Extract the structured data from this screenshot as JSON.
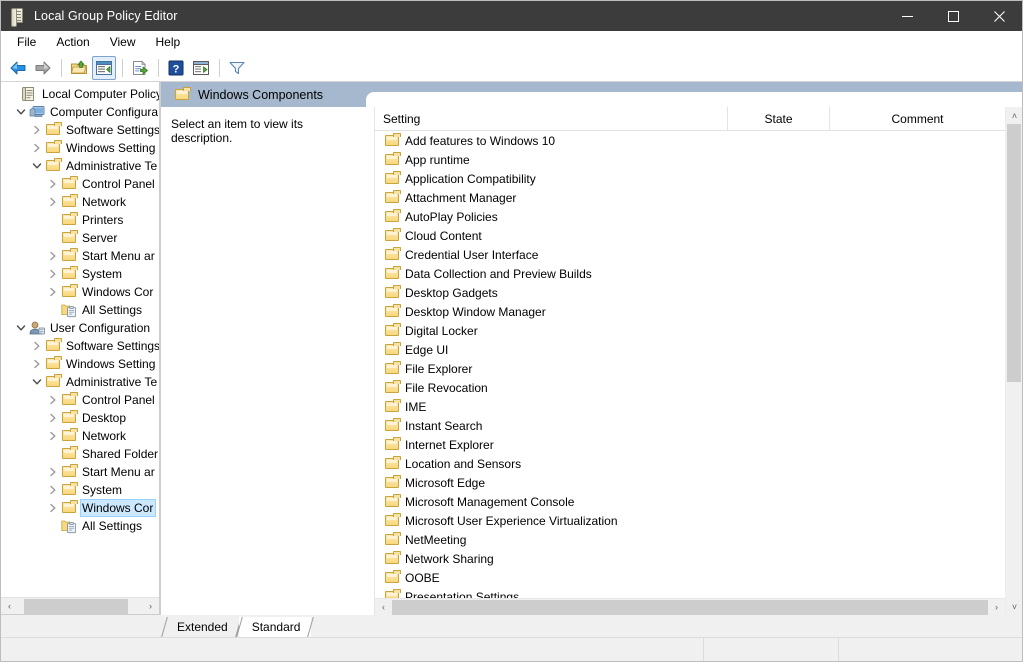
{
  "window": {
    "title": "Local Group Policy Editor",
    "icon": "scroll-policy-icon",
    "minimize_label": "—",
    "maximize_label": "□",
    "close_label": "✕"
  },
  "menubar": {
    "items": [
      {
        "label": "File"
      },
      {
        "label": "Action"
      },
      {
        "label": "View"
      },
      {
        "label": "Help"
      }
    ]
  },
  "toolbar": {
    "buttons": [
      {
        "name": "back-icon",
        "tip": "Back"
      },
      {
        "name": "forward-icon",
        "tip": "Forward"
      },
      {
        "name": "up-folder-icon",
        "tip": "Up One Level"
      },
      {
        "name": "show-hide-console-tree-icon",
        "tip": "Show/Hide Console Tree",
        "active": true
      },
      {
        "name": "export-list-icon",
        "tip": "Export List"
      },
      {
        "name": "help-icon",
        "tip": "Help"
      },
      {
        "name": "show-action-pane-icon",
        "tip": "Show/Hide Action Pane"
      },
      {
        "name": "filter-icon",
        "tip": "Filter"
      }
    ]
  },
  "tree": {
    "root": "Local Computer Policy",
    "nodes": [
      {
        "label": "Local Computer Policy",
        "depth": 0,
        "icon": "policy-icon",
        "twist": "none",
        "selected": false
      },
      {
        "label": "Computer Configura",
        "depth": 1,
        "icon": "computer-icon",
        "twist": "expanded",
        "selected": false
      },
      {
        "label": "Software Settings",
        "depth": 2,
        "icon": "folder",
        "twist": "collapsed",
        "selected": false
      },
      {
        "label": "Windows Setting",
        "depth": 2,
        "icon": "folder",
        "twist": "collapsed",
        "selected": false
      },
      {
        "label": "Administrative Te",
        "depth": 2,
        "icon": "folder",
        "twist": "expanded",
        "selected": false
      },
      {
        "label": "Control Panel",
        "depth": 3,
        "icon": "folder",
        "twist": "collapsed",
        "selected": false
      },
      {
        "label": "Network",
        "depth": 3,
        "icon": "folder",
        "twist": "collapsed",
        "selected": false
      },
      {
        "label": "Printers",
        "depth": 3,
        "icon": "folder",
        "twist": "none",
        "selected": false
      },
      {
        "label": "Server",
        "depth": 3,
        "icon": "folder",
        "twist": "none",
        "selected": false
      },
      {
        "label": "Start Menu ar",
        "depth": 3,
        "icon": "folder",
        "twist": "collapsed",
        "selected": false
      },
      {
        "label": "System",
        "depth": 3,
        "icon": "folder",
        "twist": "collapsed",
        "selected": false
      },
      {
        "label": "Windows Cor",
        "depth": 3,
        "icon": "folder",
        "twist": "collapsed",
        "selected": false
      },
      {
        "label": "All Settings",
        "depth": 3,
        "icon": "all-settings-icon",
        "twist": "none",
        "selected": false
      },
      {
        "label": "User Configuration",
        "depth": 1,
        "icon": "user-icon",
        "twist": "expanded",
        "selected": false
      },
      {
        "label": "Software Settings",
        "depth": 2,
        "icon": "folder",
        "twist": "collapsed",
        "selected": false
      },
      {
        "label": "Windows Setting",
        "depth": 2,
        "icon": "folder",
        "twist": "collapsed",
        "selected": false
      },
      {
        "label": "Administrative Te",
        "depth": 2,
        "icon": "folder",
        "twist": "expanded",
        "selected": false
      },
      {
        "label": "Control Panel",
        "depth": 3,
        "icon": "folder",
        "twist": "collapsed",
        "selected": false
      },
      {
        "label": "Desktop",
        "depth": 3,
        "icon": "folder",
        "twist": "collapsed",
        "selected": false
      },
      {
        "label": "Network",
        "depth": 3,
        "icon": "folder",
        "twist": "collapsed",
        "selected": false
      },
      {
        "label": "Shared Folder",
        "depth": 3,
        "icon": "folder",
        "twist": "none",
        "selected": false
      },
      {
        "label": "Start Menu ar",
        "depth": 3,
        "icon": "folder",
        "twist": "collapsed",
        "selected": false
      },
      {
        "label": "System",
        "depth": 3,
        "icon": "folder",
        "twist": "collapsed",
        "selected": false
      },
      {
        "label": "Windows Cor",
        "depth": 3,
        "icon": "folder",
        "twist": "collapsed",
        "selected": true
      },
      {
        "label": "All Settings",
        "depth": 3,
        "icon": "all-settings-icon",
        "twist": "none",
        "selected": false
      }
    ],
    "hscroll": {
      "left_arrow": "‹",
      "right_arrow": "›"
    }
  },
  "content": {
    "header_title": "Windows Components",
    "header_icon": "folder-icon",
    "description": "Select an item to view its description.",
    "columns": [
      {
        "label": "Setting",
        "key": "setting"
      },
      {
        "label": "State",
        "key": "state"
      },
      {
        "label": "Comment",
        "key": "comment"
      }
    ],
    "rows": [
      {
        "setting": "Add features to Windows 10",
        "state": "",
        "comment": ""
      },
      {
        "setting": "App runtime",
        "state": "",
        "comment": ""
      },
      {
        "setting": "Application Compatibility",
        "state": "",
        "comment": ""
      },
      {
        "setting": "Attachment Manager",
        "state": "",
        "comment": ""
      },
      {
        "setting": "AutoPlay Policies",
        "state": "",
        "comment": ""
      },
      {
        "setting": "Cloud Content",
        "state": "",
        "comment": ""
      },
      {
        "setting": "Credential User Interface",
        "state": "",
        "comment": ""
      },
      {
        "setting": "Data Collection and Preview Builds",
        "state": "",
        "comment": ""
      },
      {
        "setting": "Desktop Gadgets",
        "state": "",
        "comment": ""
      },
      {
        "setting": "Desktop Window Manager",
        "state": "",
        "comment": ""
      },
      {
        "setting": "Digital Locker",
        "state": "",
        "comment": ""
      },
      {
        "setting": "Edge UI",
        "state": "",
        "comment": ""
      },
      {
        "setting": "File Explorer",
        "state": "",
        "comment": ""
      },
      {
        "setting": "File Revocation",
        "state": "",
        "comment": ""
      },
      {
        "setting": "IME",
        "state": "",
        "comment": ""
      },
      {
        "setting": "Instant Search",
        "state": "",
        "comment": ""
      },
      {
        "setting": "Internet Explorer",
        "state": "",
        "comment": ""
      },
      {
        "setting": "Location and Sensors",
        "state": "",
        "comment": ""
      },
      {
        "setting": "Microsoft Edge",
        "state": "",
        "comment": ""
      },
      {
        "setting": "Microsoft Management Console",
        "state": "",
        "comment": ""
      },
      {
        "setting": "Microsoft User Experience Virtualization",
        "state": "",
        "comment": ""
      },
      {
        "setting": "NetMeeting",
        "state": "",
        "comment": ""
      },
      {
        "setting": "Network Sharing",
        "state": "",
        "comment": ""
      },
      {
        "setting": "OOBE",
        "state": "",
        "comment": ""
      },
      {
        "setting": "Presentation Settings",
        "state": "",
        "comment": ""
      }
    ],
    "vscroll": {
      "up_arrow": "˄",
      "down_arrow": "˅"
    },
    "hscroll": {
      "left_arrow": "‹",
      "right_arrow": "›"
    }
  },
  "tabs": [
    {
      "label": "Extended",
      "active": false
    },
    {
      "label": "Standard",
      "active": true
    }
  ],
  "statusbar": {
    "panes": [
      "",
      "",
      ""
    ]
  },
  "colors": {
    "titlebar_bg": "#3c3c3c",
    "header_band": "#a6b8cd",
    "selection": "#cce8ff",
    "chrome": "#f0f0f0",
    "folder_gold": "#f8d77d"
  }
}
